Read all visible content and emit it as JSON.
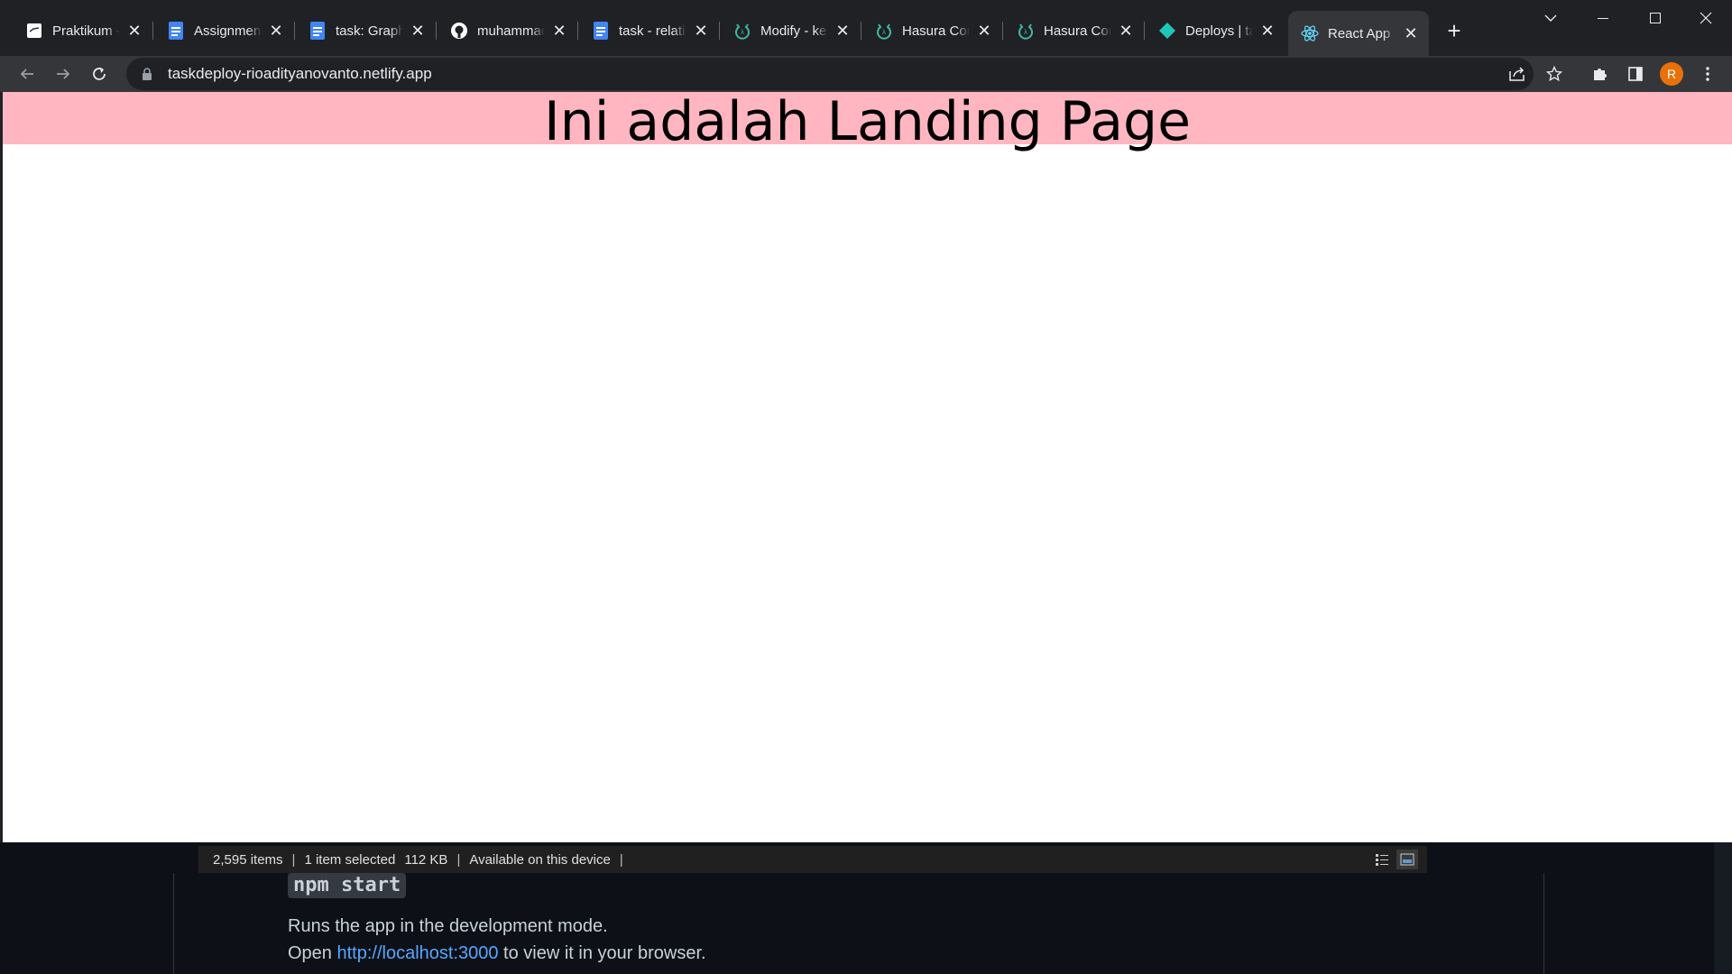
{
  "browser": {
    "tabs": [
      {
        "title": "Praktikum -",
        "favicon": "doc-white-icon",
        "active": false
      },
      {
        "title": "Assignment",
        "favicon": "google-docs-icon",
        "active": false
      },
      {
        "title": "task: Graph",
        "favicon": "google-docs-icon",
        "active": false
      },
      {
        "title": "muhammad",
        "favicon": "github-icon",
        "active": false
      },
      {
        "title": "task - relati",
        "favicon": "google-docs-icon",
        "active": false
      },
      {
        "title": "Modify - ke",
        "favicon": "hasura-icon",
        "active": false
      },
      {
        "title": "Hasura Con",
        "favicon": "hasura-icon",
        "active": false
      },
      {
        "title": "Hasura Con",
        "favicon": "hasura-icon",
        "active": false
      },
      {
        "title": "Deploys | ta",
        "favicon": "netlify-icon",
        "active": false
      },
      {
        "title": "React App",
        "favicon": "react-icon",
        "active": true
      }
    ],
    "new_tab_label": "+",
    "url": "taskdeploy-rioadityanovanto.netlify.app",
    "profile_initial": "R",
    "colors": {
      "tab_strip": "#202124",
      "toolbar": "#35363a",
      "avatar": "#e8710a"
    }
  },
  "page": {
    "heading": "Ini adalah Landing Page",
    "banner_color": "#ffb6c1"
  },
  "explorer_status": {
    "item_count": "2,595 items",
    "selection": "1 item selected",
    "size": "112 KB",
    "availability": "Available on this device"
  },
  "readme": {
    "command": "npm start",
    "line1": "Runs the app in the development mode.",
    "line2_prefix": "Open ",
    "line2_link": "http://localhost:3000",
    "line2_suffix": " to view it in your browser."
  }
}
